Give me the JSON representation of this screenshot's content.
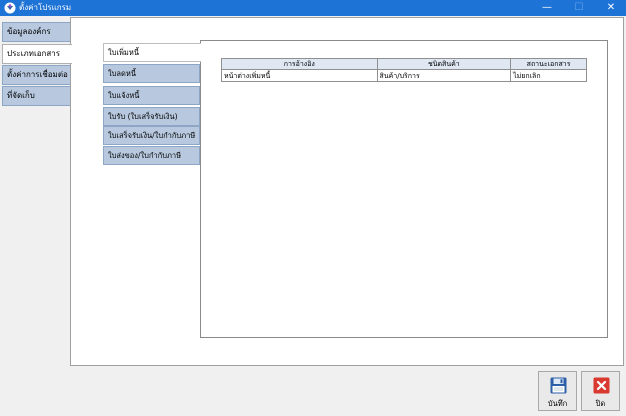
{
  "window": {
    "title": "ตั้งค่าโปรแกรม",
    "controls": {
      "minimize": "—",
      "maximize": "☐",
      "close": "✕"
    }
  },
  "outer_tabs": [
    {
      "label": "ข้อมูลองค์กร",
      "active": false
    },
    {
      "label": "ประเภทเอกสาร",
      "active": true
    },
    {
      "label": "ตั้งค่าการเชื่อมต่อ",
      "active": false
    },
    {
      "label": "ที่จัดเก็บ",
      "active": false
    }
  ],
  "inner_tabs": [
    {
      "label": "ใบเพิ่มหนี้",
      "active": true
    },
    {
      "label": "ใบลดหนี้",
      "active": false
    },
    {
      "label": "ใบแจ้งหนี้",
      "active": false
    },
    {
      "label": "ใบรับ (ใบเสร็จรับเงิน)",
      "active": false
    },
    {
      "label": "ใบเสร็จรับเงิน/ใบกำกับภาษี",
      "active": false
    },
    {
      "label": "ใบส่งของ/ใบกำกับภาษี",
      "active": false
    }
  ],
  "table": {
    "headers": [
      "การอ้างอิง",
      "ชนิดสินค้า",
      "สถานะเอกสาร"
    ],
    "rows": [
      [
        "หน้าต่างเพิ่มหนี้",
        "สินค้า/บริการ",
        "ไม่ยกเลิก"
      ]
    ]
  },
  "buttons": {
    "save_label": "บันทึก",
    "close_label": "ปิด"
  },
  "colors": {
    "titlebar": "#1e73d6",
    "tab_inactive": "#b8c9df",
    "close_icon": "#d9392f",
    "save_icon": "#2d5ea8"
  },
  "icons": {
    "app": "app-icon",
    "save": "floppy-disk-icon",
    "close": "close-x-icon"
  }
}
